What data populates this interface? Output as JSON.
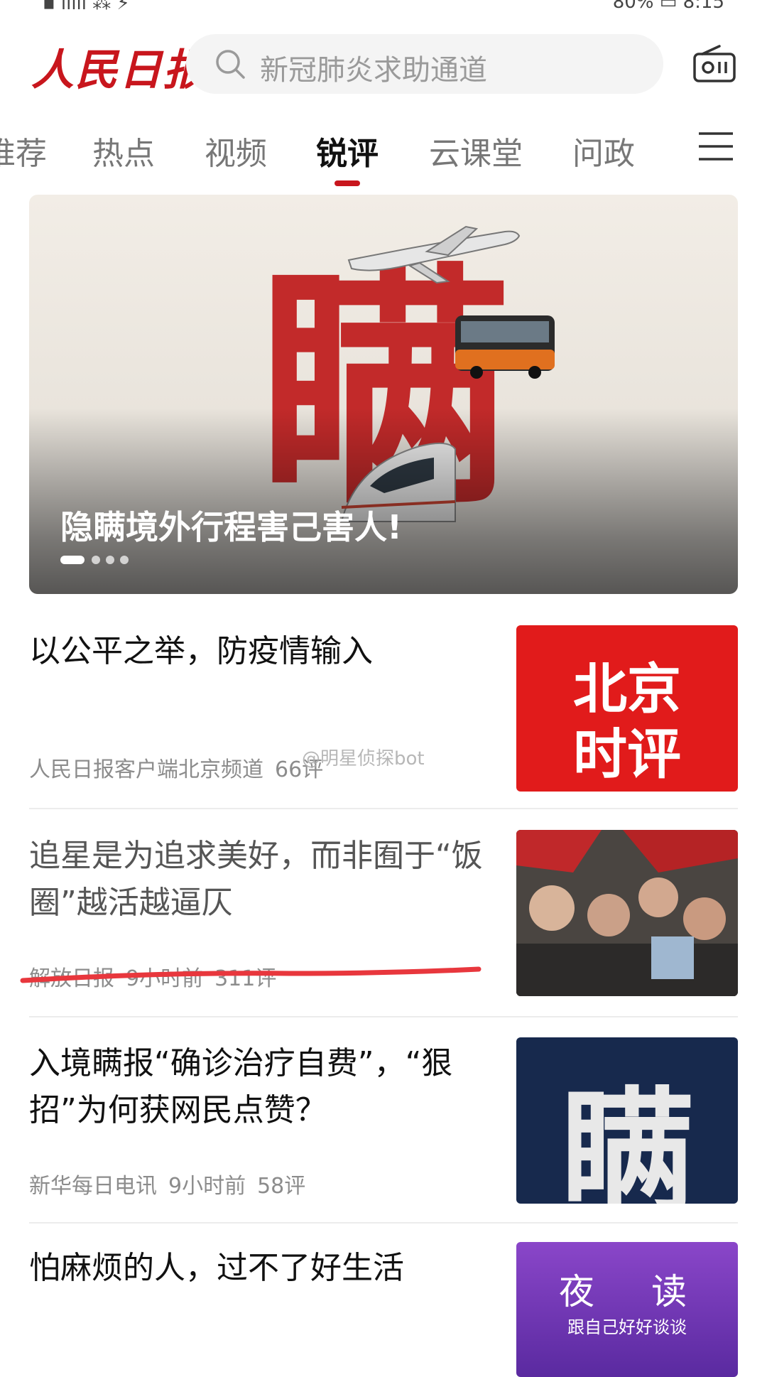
{
  "status": {
    "left": "▪ ıılll ⁂ ⚡",
    "right": "80% ▭ 8:15"
  },
  "header": {
    "logo": "人民日报",
    "search_placeholder": "新冠肺炎求助通道"
  },
  "tabs": [
    {
      "label": "推荐",
      "active": false
    },
    {
      "label": "热点",
      "active": false
    },
    {
      "label": "视频",
      "active": false
    },
    {
      "label": "锐评",
      "active": true
    },
    {
      "label": "云课堂",
      "active": false
    },
    {
      "label": "问政",
      "active": false
    }
  ],
  "banner": {
    "title": "隐瞒境外行程害己害人!",
    "graphic_text": "瞒",
    "slide": 1,
    "slide_count": 4
  },
  "articles": [
    {
      "title": "以公平之举，防疫情输入",
      "source": "人民日报客户端北京频道",
      "time": "",
      "comments": "66评",
      "thumb_text": [
        "北京",
        "时评"
      ]
    },
    {
      "title": "追星是为追求美好，而非囿于“饭圈”越活越逼仄",
      "source": "解放日报",
      "time": "9小时前",
      "comments": "311评",
      "thumb_text": []
    },
    {
      "title": "入境瞒报“确诊治疗自费”，“狠招”为何获网民点赞？",
      "source": "新华每日电讯",
      "time": "9小时前",
      "comments": "58评",
      "thumb_text": [
        "瞒"
      ]
    },
    {
      "title": "怕麻烦的人，过不了好生活",
      "source": "",
      "time": "",
      "comments": "",
      "thumb_text": [
        "夜",
        "读",
        "跟自己好好谈谈"
      ]
    }
  ],
  "watermark": "@明星侦探bot",
  "colors": {
    "brand_red": "#c8161d",
    "highlight_underline": "#e8373d",
    "night_read_purple": "#8a46c9"
  }
}
